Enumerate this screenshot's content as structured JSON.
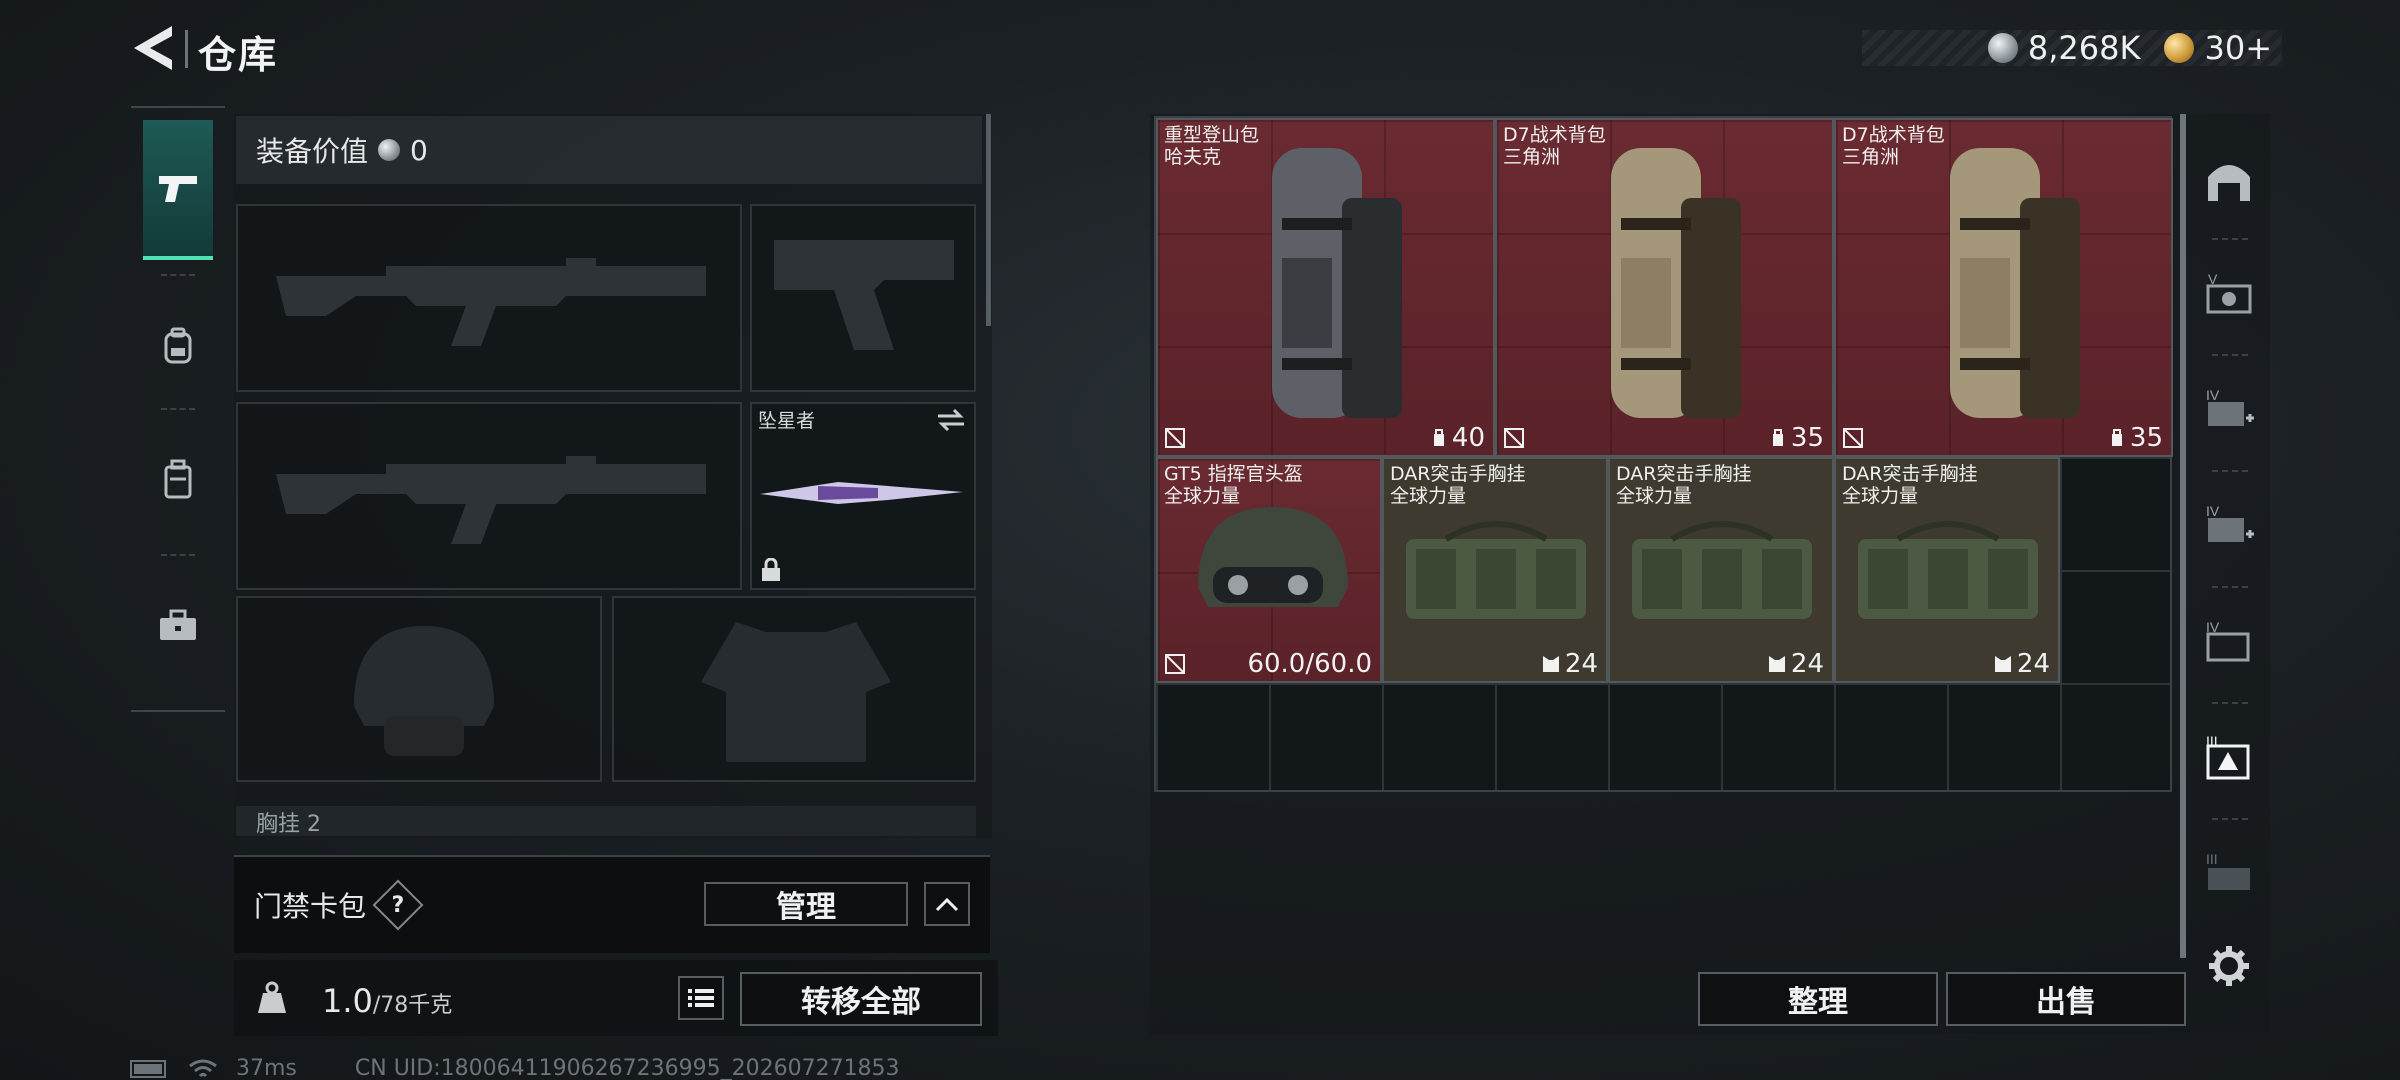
{
  "header": {
    "title": "仓库",
    "currency": [
      {
        "name": "coin-silver",
        "value": "8,268K"
      },
      {
        "name": "coin-gold",
        "value": "30+"
      }
    ]
  },
  "tabs": [
    {
      "id": "weapons",
      "icon": "pistol-icon",
      "active": true
    },
    {
      "id": "backpack",
      "icon": "backpack-icon",
      "active": false
    },
    {
      "id": "vest",
      "icon": "vest-icon",
      "active": false
    },
    {
      "id": "case",
      "icon": "briefcase-icon",
      "active": false
    }
  ],
  "loadout": {
    "value_label": "装备价值",
    "value": "0",
    "melee_name": "坠星者",
    "chest_hint": "胸挂 2"
  },
  "card_pack": {
    "label": "门禁卡包",
    "help": "?",
    "manage_label": "管理"
  },
  "weight": {
    "current": "1.0",
    "max": "/78千克",
    "transfer_all_label": "转移全部"
  },
  "status": {
    "ping": "37ms",
    "uid": "CN UID:18006411906267236995_202607271853"
  },
  "stash": {
    "items": [
      {
        "name_line1": "重型登山包",
        "name_line2": "哈夫克",
        "count": "40",
        "type": "backpack",
        "color": "red",
        "tone": "grey"
      },
      {
        "name_line1": "D7战术背包",
        "name_line2": "三角洲",
        "count": "35",
        "type": "backpack",
        "color": "red",
        "tone": "tan"
      },
      {
        "name_line1": "D7战术背包",
        "name_line2": "三角洲",
        "count": "35",
        "type": "backpack",
        "color": "red",
        "tone": "tan"
      },
      {
        "name_line1": "GT5 指挥官头盔",
        "name_line2": "全球力量",
        "count": "60.0/60.0",
        "type": "helmet",
        "color": "red"
      },
      {
        "name_line1": "DAR突击手胸挂",
        "name_line2": "全球力量",
        "count": "24",
        "type": "rig",
        "color": "olive"
      },
      {
        "name_line1": "DAR突击手胸挂",
        "name_line2": "全球力量",
        "count": "24",
        "type": "rig",
        "color": "olive"
      },
      {
        "name_line1": "DAR突击手胸挂",
        "name_line2": "全球力量",
        "count": "24",
        "type": "rig",
        "color": "olive"
      }
    ],
    "sort_label": "整理",
    "sell_label": "出售"
  },
  "colors": {
    "accent": "#4fe0b3",
    "item_red": "#6a2a31",
    "item_olive": "#3e3a2f"
  }
}
